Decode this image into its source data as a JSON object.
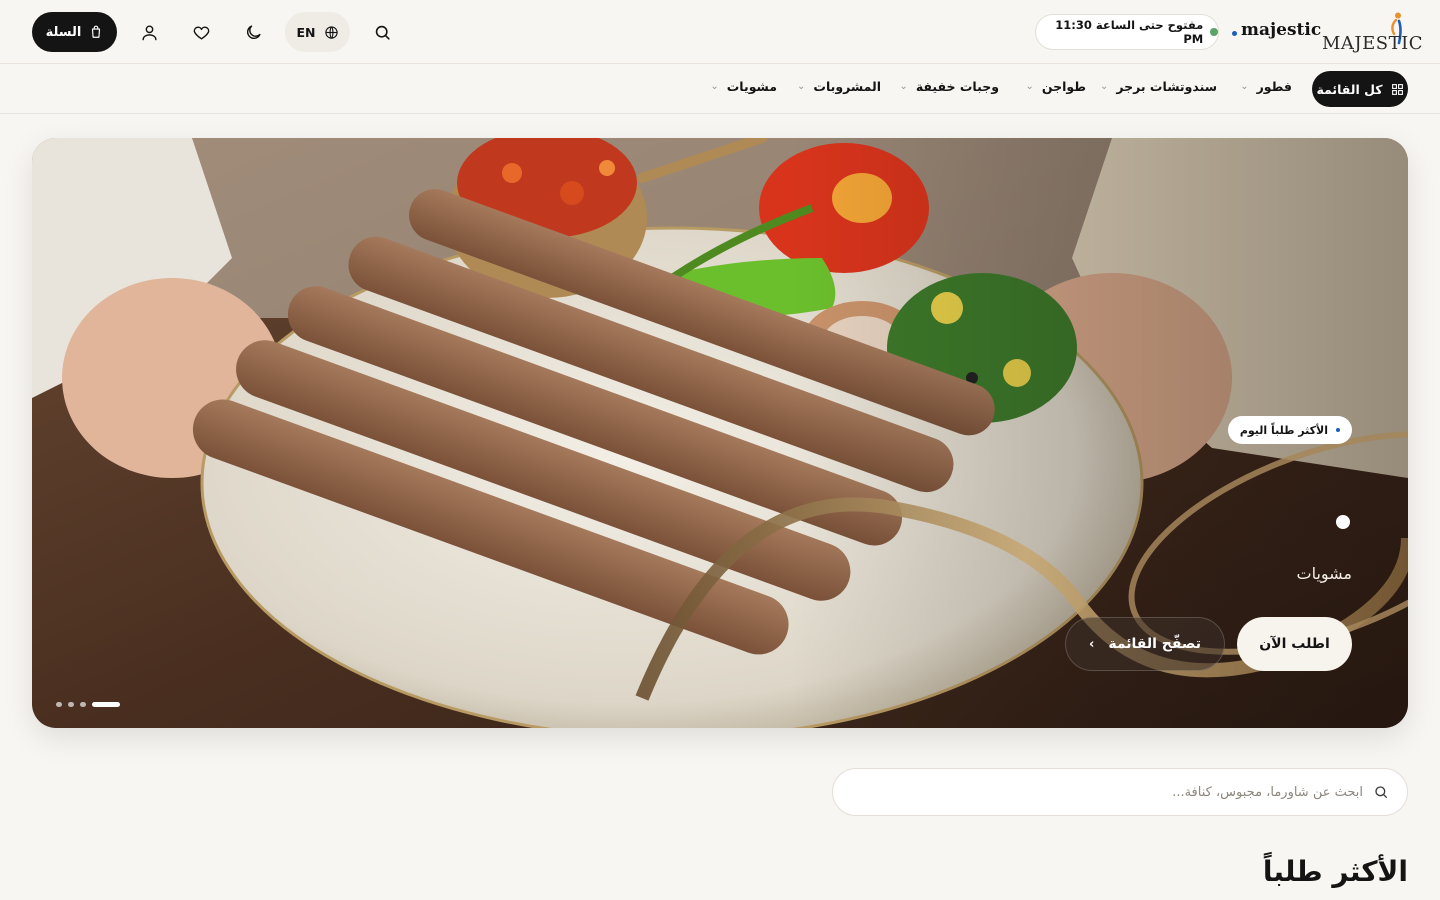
{
  "header": {
    "cart_label": "السلة",
    "lang_label": "EN",
    "status_text": "مفتوح حتى الساعة 11:30 PM",
    "brand_name": "majestic",
    "logo_text": "MAJESTIC"
  },
  "nav": {
    "all_menu_label": "كل القائمة",
    "categories": [
      {
        "label": "فطور"
      },
      {
        "label": "سندوتشات برجر"
      },
      {
        "label": "طواجن"
      },
      {
        "label": "وجبات خفيفة"
      },
      {
        "label": "المشروبات"
      },
      {
        "label": "مشويات"
      }
    ]
  },
  "hero": {
    "badge": "الأكثر طلباً اليوم",
    "title": "مشويات",
    "order_button": "اطلب الآن",
    "browse_button": "تصفّح القائمة",
    "slides_count": 4,
    "active_slide": 1
  },
  "search": {
    "placeholder": "ابحث عن شاورما، مجبوس، كنافة..."
  },
  "section": {
    "title": "الأكثر طلباً"
  },
  "icons": {
    "cart": "shopping-bag-icon",
    "user": "user-icon",
    "wishlist": "heart-icon",
    "theme": "moon-icon",
    "language": "globe-icon",
    "search": "search-icon",
    "grid": "grid-icon"
  },
  "colors": {
    "background": "#f8f6f2",
    "primary": "#141414",
    "open_status": "#5aa468",
    "accent_dot": "#1d5fb8"
  }
}
